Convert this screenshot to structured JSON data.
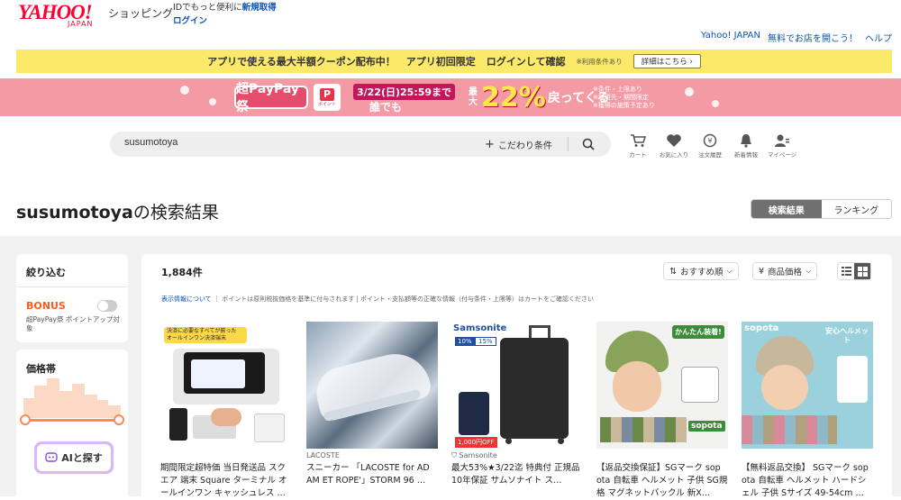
{
  "header": {
    "logo_main": "YAHOO!",
    "logo_sub": "JAPAN",
    "shop_label": "ショッピング",
    "login_hint_prefix": "IDでもっと便利に",
    "signup_link": "新規取得",
    "login_link": "ログイン",
    "top_links": [
      "Yahoo! JAPAN",
      "無料でお店を開こう！",
      "ヘルプ"
    ]
  },
  "promo_bar": {
    "text1": "アプリで使える最大半額クーポン配布中！",
    "text2": "アプリ初回限定",
    "text3": "ログインして確認",
    "note": "※利用条件あり",
    "button": "詳細はこちら ›"
  },
  "campaign": {
    "badge": "超PayPay祭",
    "points_icon_letter": "P",
    "points_icon_text": "ポイント",
    "date": "3/22(日)25:59まで",
    "anyone": "誰でも",
    "max_label": "最大",
    "percent": "22%",
    "back": "戻ってくる",
    "notes": [
      "※条件・上限あり",
      "※利用先・期間限定",
      "※獲得の施策予定あり"
    ]
  },
  "search": {
    "value": "susumotoya",
    "kodawari": "こだわり条件"
  },
  "nav": [
    {
      "label": "カート",
      "icon": "cart-icon"
    },
    {
      "label": "お気に入り",
      "icon": "heart-icon"
    },
    {
      "label": "注文履歴",
      "icon": "order-history-icon"
    },
    {
      "label": "新着情報",
      "icon": "bell-icon"
    },
    {
      "label": "マイページ",
      "icon": "user-icon"
    }
  ],
  "title": {
    "query": "susumotoya",
    "suffix": "の検索結果"
  },
  "tabs": {
    "results": "検索結果",
    "ranking": "ランキング"
  },
  "sidebar": {
    "filter_title": "絞り込む",
    "bonus_label": "BONUS",
    "bonus_desc": "超PayPay祭 ポイントアップ対象",
    "price_title": "価格帯",
    "ai_button": "AIと探す"
  },
  "results": {
    "count": "1,884件",
    "sort": "おすすめ順",
    "price_sort": "商品価格",
    "disclaimer_link": "表示情報について",
    "disclaimer_text": "ポイントは原則税抜価格を基準に付与されます | ポイント・支払額等の正確な情報（付与条件・上限等）はカートをご確認ください",
    "products": [
      {
        "brand": "",
        "title": "期間限定超特価 当日発送品 スクエア 端末 Square ターミナル オールインワン キャッシュレス …",
        "img_caption": "決済に必要なすべてが揃った",
        "img_caption2": "オールインワン決済端末"
      },
      {
        "brand": "LACOSTE",
        "title": "スニーカー 「LACOSTE for AD AM ET ROPE'」STORM 96 …"
      },
      {
        "brand": "Samsonite",
        "title": "最大53%★3/22迄 特典付 正規品10年保証 サムソナイト ス…",
        "img_brand": "Samsonite",
        "img_tag1": "10%",
        "img_tag2": "15%",
        "img_price": "1,000円OFF"
      },
      {
        "brand": "",
        "title": "【返品交換保証】SGマーク sop ota 自転車 ヘルメット 子供 SG規格 マグネットバックル 新X…",
        "img_caption": "かんたん装着!",
        "img_brand": "sopota"
      },
      {
        "brand": "",
        "title": "【無料返品交換】 SGマーク sop ota 自転車 ヘルメット ハードシェル 子供 Sサイズ 49-54cm …",
        "img_caption": "安心ヘルメット",
        "img_brand": "sopota"
      }
    ]
  },
  "colors": {
    "yahoo_red": "#ff0033",
    "link_blue": "#0a53b6",
    "promo_yellow": "#fbe96a",
    "campaign_pink": "#f49aa4",
    "bonus_orange": "#ff5a1f"
  }
}
